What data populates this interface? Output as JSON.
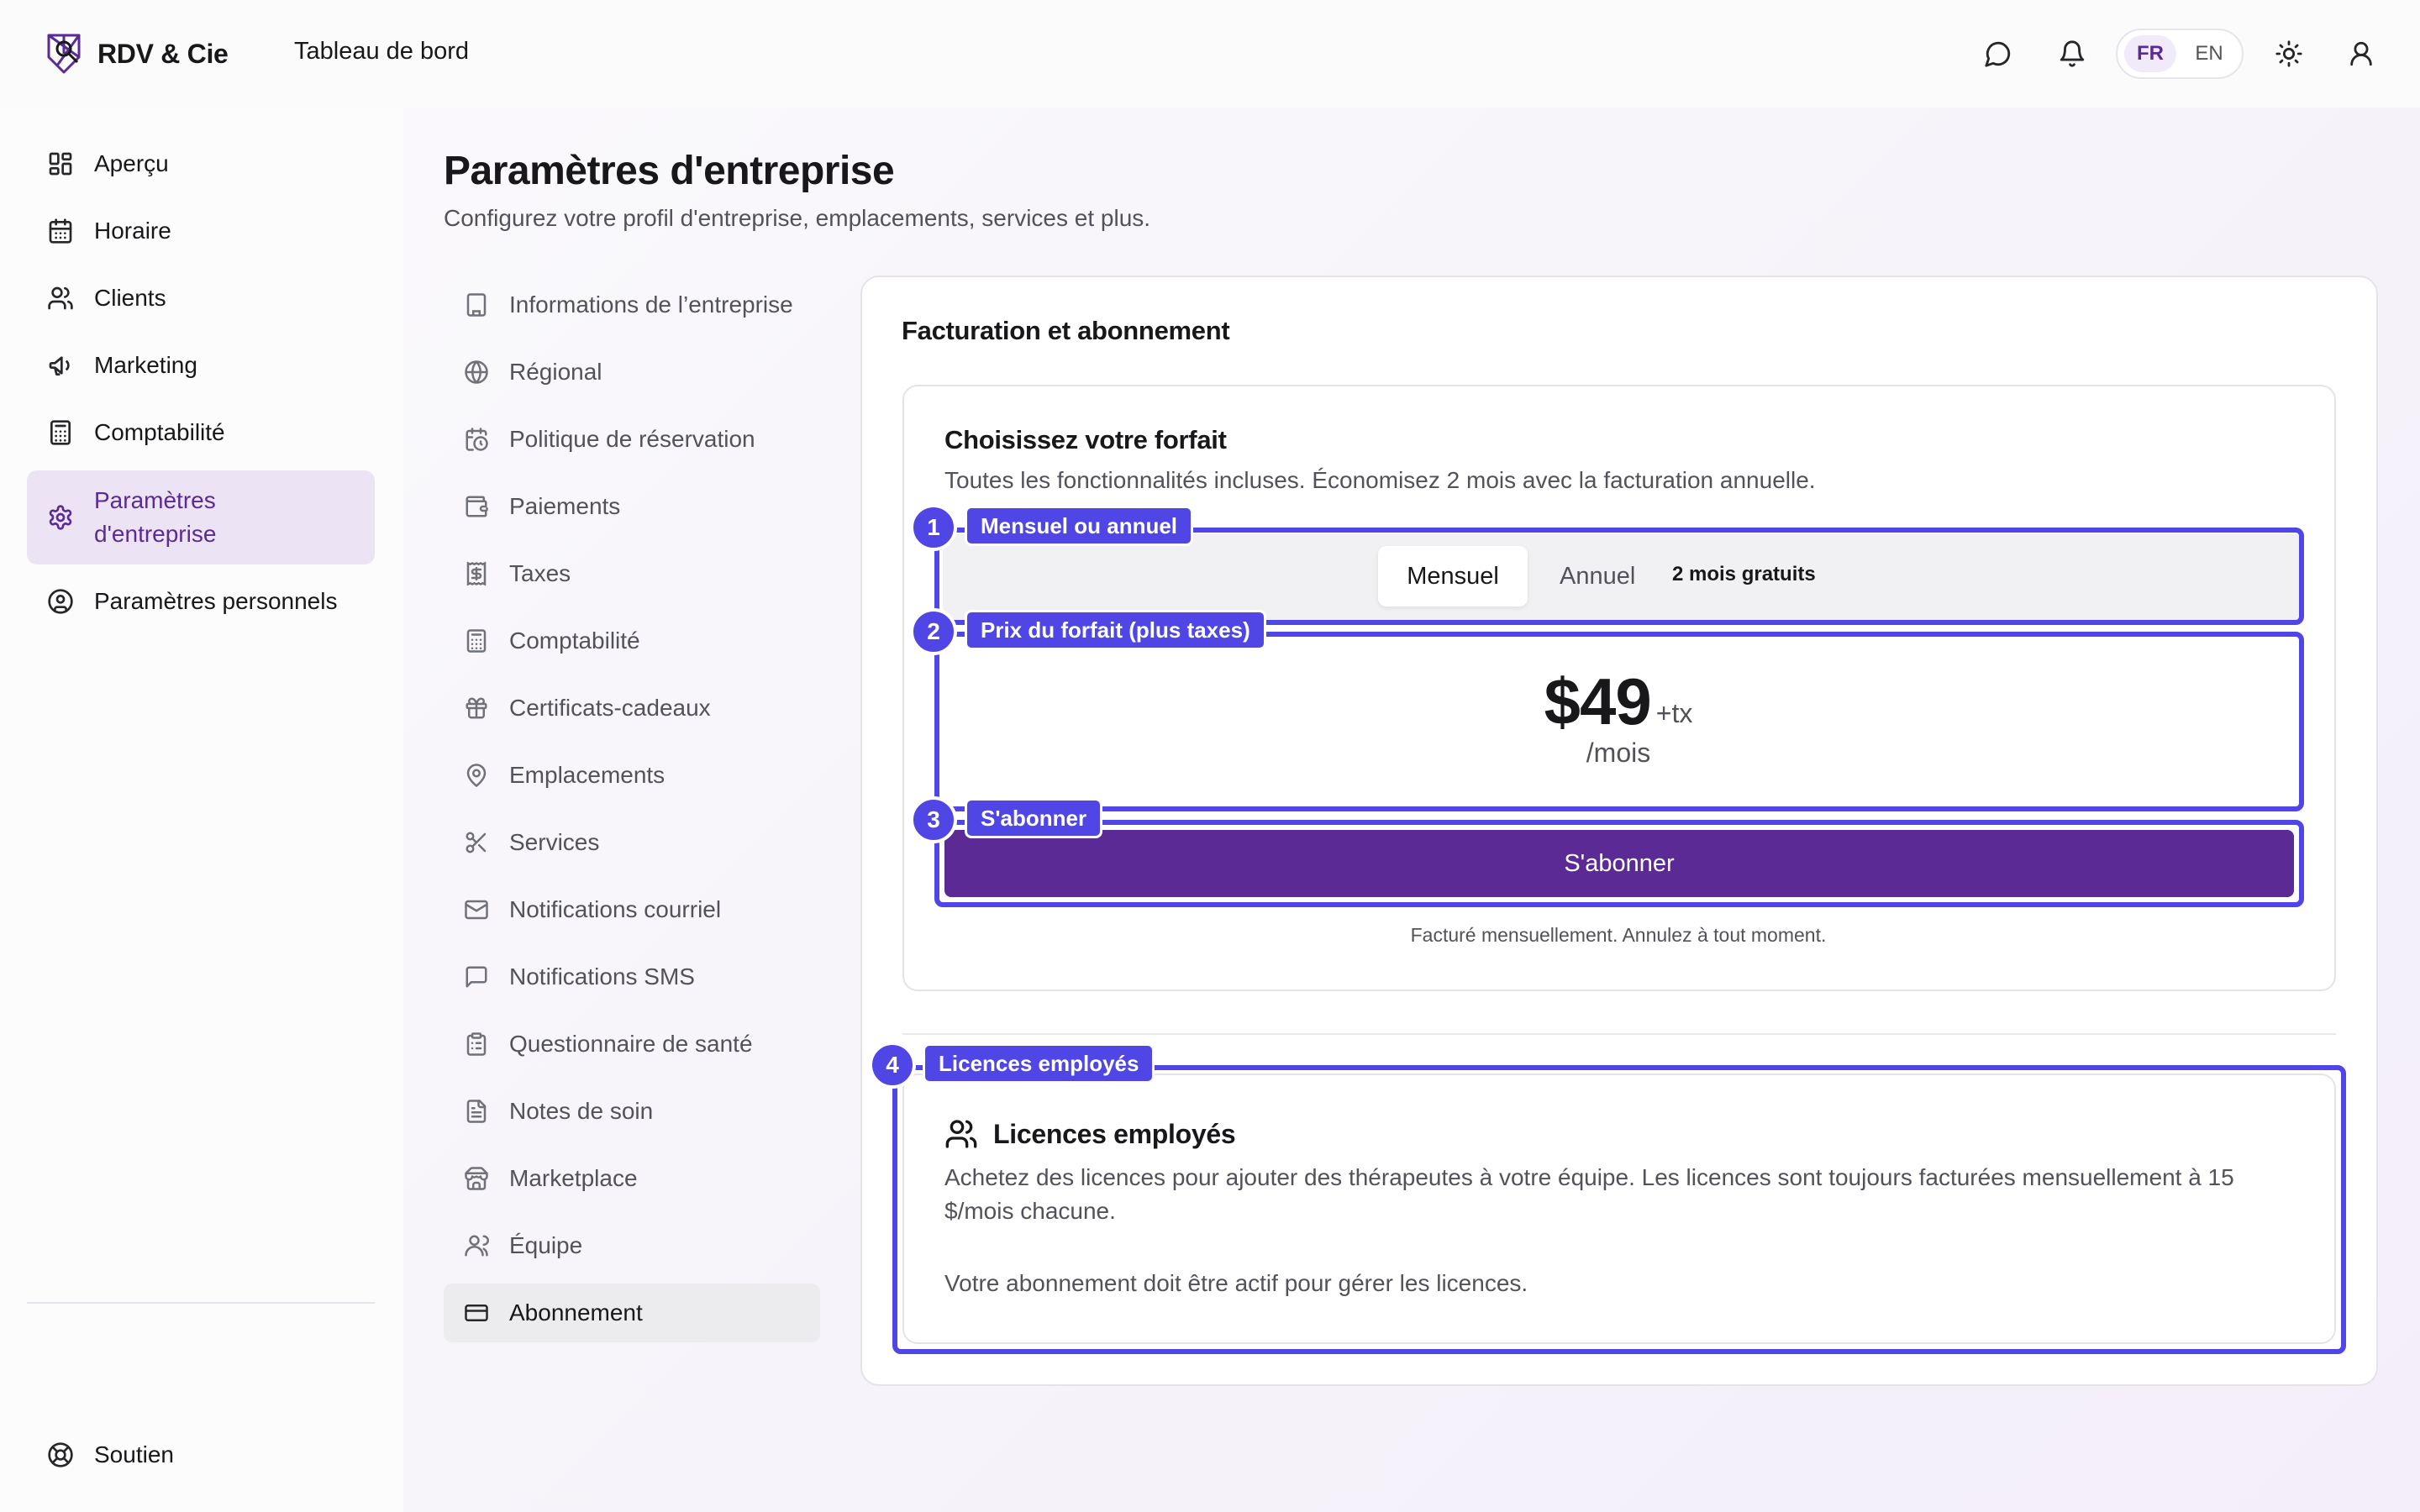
{
  "app": {
    "name": "RDV & Cie",
    "header_title": "Tableau de bord"
  },
  "header": {
    "languages": [
      {
        "code": "FR",
        "active": true
      },
      {
        "code": "EN",
        "active": false
      }
    ],
    "icons": [
      "chat-icon",
      "bell-icon",
      "sun-icon",
      "user-icon"
    ]
  },
  "sidebar": {
    "items": [
      {
        "label": "Aperçu",
        "icon": "grid-icon",
        "active": false
      },
      {
        "label": "Horaire",
        "icon": "calendar-icon",
        "active": false
      },
      {
        "label": "Clients",
        "icon": "users-icon",
        "active": false
      },
      {
        "label": "Marketing",
        "icon": "megaphone-icon",
        "active": false
      },
      {
        "label": "Comptabilité",
        "icon": "calculator-icon",
        "active": false
      },
      {
        "label": "Paramètres d'entreprise",
        "icon": "gear-icon",
        "active": true
      },
      {
        "label": "Paramètres personnels",
        "icon": "user-circle-icon",
        "active": false
      }
    ],
    "support": {
      "label": "Soutien",
      "icon": "lifebuoy-icon"
    }
  },
  "page": {
    "title": "Paramètres d'entreprise",
    "subtitle": "Configurez votre profil d'entreprise, emplacements, services et plus."
  },
  "settings_nav": [
    {
      "label": "Informations de l’entreprise",
      "icon": "building-icon"
    },
    {
      "label": "Régional",
      "icon": "globe-icon"
    },
    {
      "label": "Politique de réservation",
      "icon": "calendar-clock-icon"
    },
    {
      "label": "Paiements",
      "icon": "wallet-icon"
    },
    {
      "label": "Taxes",
      "icon": "receipt-icon"
    },
    {
      "label": "Comptabilité",
      "icon": "calculator-icon"
    },
    {
      "label": "Certificats-cadeaux",
      "icon": "gift-icon"
    },
    {
      "label": "Emplacements",
      "icon": "map-pin-icon"
    },
    {
      "label": "Services",
      "icon": "scissors-icon"
    },
    {
      "label": "Notifications courriel",
      "icon": "mail-icon"
    },
    {
      "label": "Notifications SMS",
      "icon": "message-square-icon"
    },
    {
      "label": "Questionnaire de santé",
      "icon": "clipboard-icon"
    },
    {
      "label": "Notes de soin",
      "icon": "file-text-icon"
    },
    {
      "label": "Marketplace",
      "icon": "store-icon"
    },
    {
      "label": "Équipe",
      "icon": "user-group-icon"
    },
    {
      "label": "Abonnement",
      "icon": "credit-card-icon",
      "active": true
    }
  ],
  "billing": {
    "section_title": "Facturation et abonnement",
    "plan": {
      "title": "Choisissez votre forfait",
      "subtitle": "Toutes les fonctionnalités incluses. Économisez 2 mois avec la facturation annuelle.",
      "toggle": {
        "monthly": "Mensuel",
        "annual": "Annuel",
        "annual_badge": "2 mois gratuits",
        "selected": "monthly"
      },
      "price": "$49",
      "tax_suffix": "+tx",
      "period": "/mois",
      "subscribe_label": "S'abonner",
      "note": "Facturé mensuellement. Annulez à tout moment."
    },
    "licenses": {
      "title": "Licences employés",
      "description": "Achetez des licences pour ajouter des thérapeutes à votre équipe. Les licences sont toujours facturées mensuellement à 15 $/mois chacune.",
      "note": "Votre abonnement doit être actif pour gérer les licences."
    }
  },
  "annotations": [
    {
      "number": "1",
      "label": "Mensuel ou annuel"
    },
    {
      "number": "2",
      "label": "Prix du forfait (plus taxes)"
    },
    {
      "number": "3",
      "label": "S'abonner"
    },
    {
      "number": "4",
      "label": "Licences employés"
    }
  ],
  "colors": {
    "brand": "#5b2a95",
    "annotation": "#4f46e5",
    "active_nav_bg": "#ece4f4"
  }
}
